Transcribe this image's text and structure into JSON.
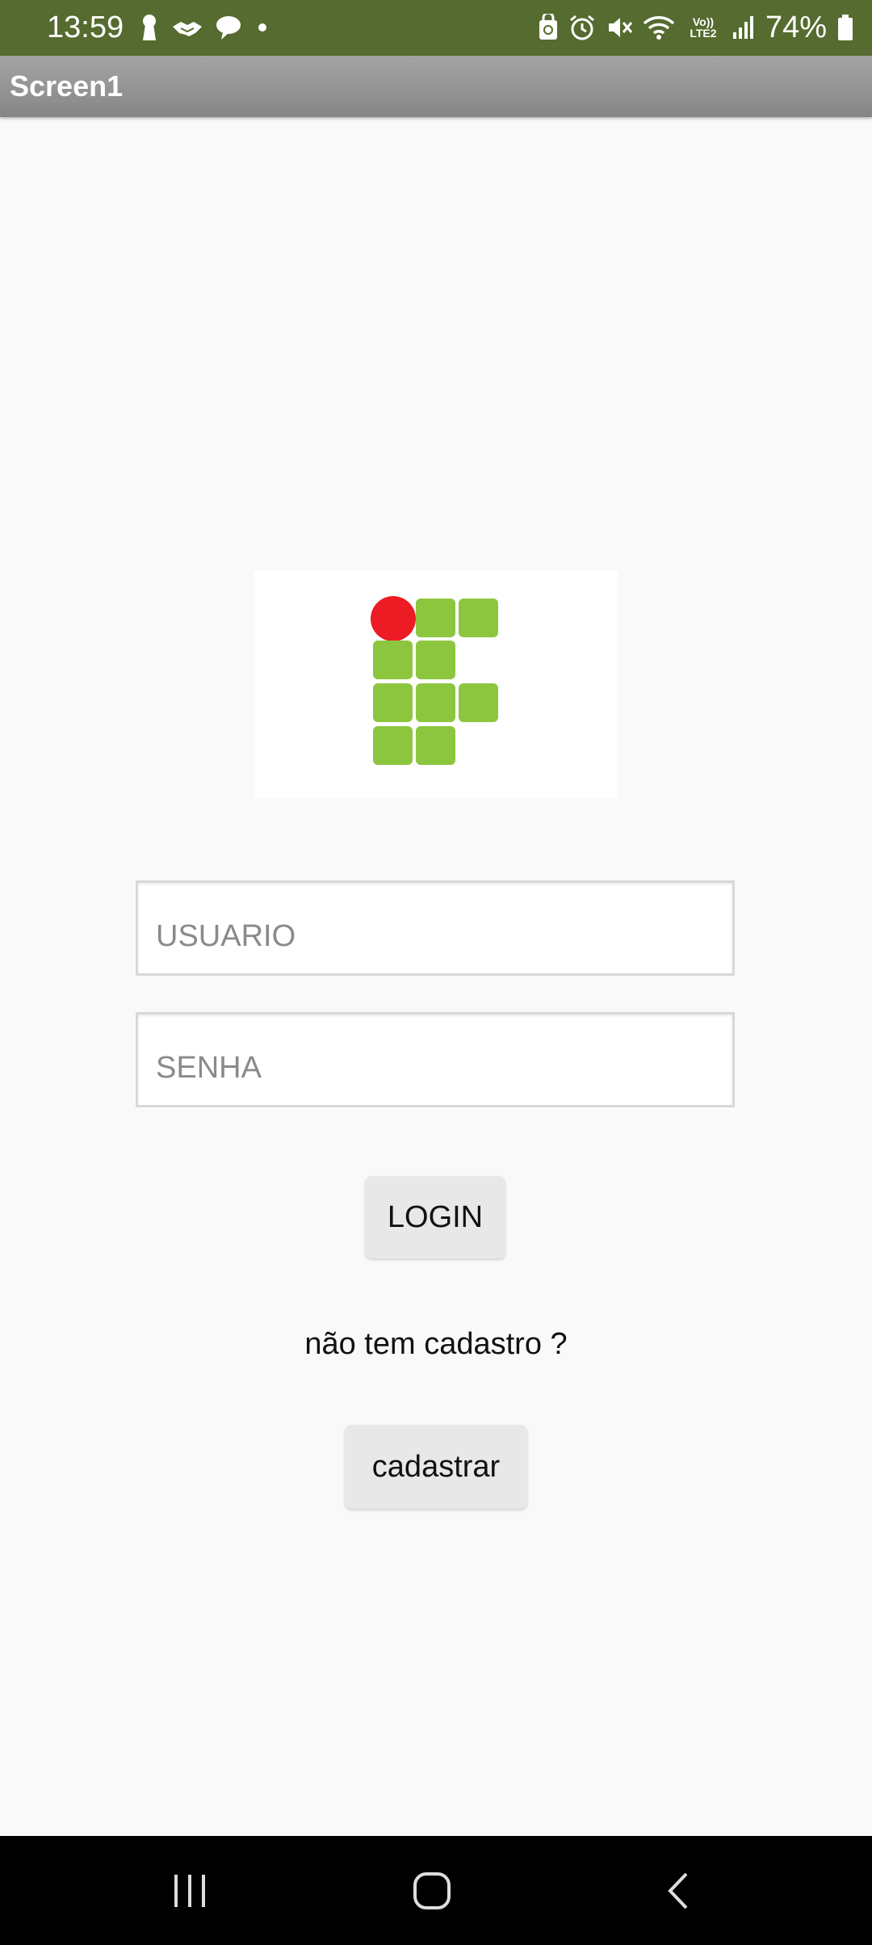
{
  "status_bar": {
    "time": "13:59",
    "left_icons": [
      "keyhole-notification-icon",
      "handshake-notification-icon",
      "chat-bubble-notification-icon",
      "more-notifications-dot-icon"
    ],
    "right_icons": [
      "recycle-lock-icon",
      "alarm-icon",
      "mute-icon",
      "wifi-icon",
      "volte-icon",
      "signal-icon"
    ],
    "volte_label": "Vo)) LTE2",
    "battery_percent": "74%",
    "battery_level": 0.74,
    "background_color": "#556b2f"
  },
  "app_bar": {
    "title": "Screen1"
  },
  "logo": {
    "name": "if-institute-logo",
    "dot_color": "#ed1c24",
    "square_color": "#8cc63f"
  },
  "form": {
    "username_placeholder": "USUARIO",
    "username_value": "",
    "password_placeholder": "SENHA",
    "password_value": "",
    "login_label": "LOGIN",
    "question_text": "não tem cadastro ?",
    "register_label": "cadastrar"
  },
  "nav_bar": {
    "items": [
      "recent-apps-icon",
      "home-icon",
      "back-icon"
    ]
  }
}
